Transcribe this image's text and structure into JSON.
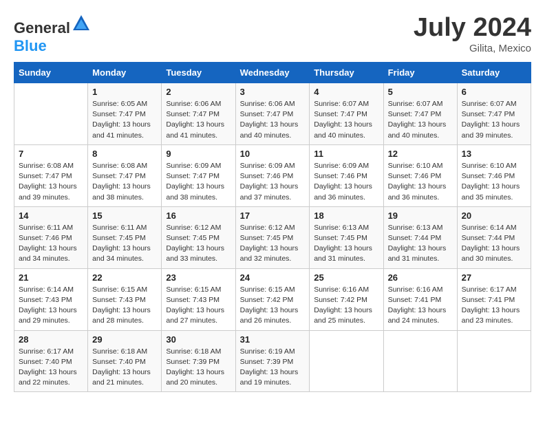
{
  "header": {
    "logo_general": "General",
    "logo_blue": "Blue",
    "month_year": "July 2024",
    "location": "Gilita, Mexico"
  },
  "days_of_week": [
    "Sunday",
    "Monday",
    "Tuesday",
    "Wednesday",
    "Thursday",
    "Friday",
    "Saturday"
  ],
  "weeks": [
    [
      {
        "day": "",
        "info": ""
      },
      {
        "day": "1",
        "info": "Sunrise: 6:05 AM\nSunset: 7:47 PM\nDaylight: 13 hours and 41 minutes."
      },
      {
        "day": "2",
        "info": "Sunrise: 6:06 AM\nSunset: 7:47 PM\nDaylight: 13 hours and 41 minutes."
      },
      {
        "day": "3",
        "info": "Sunrise: 6:06 AM\nSunset: 7:47 PM\nDaylight: 13 hours and 40 minutes."
      },
      {
        "day": "4",
        "info": "Sunrise: 6:07 AM\nSunset: 7:47 PM\nDaylight: 13 hours and 40 minutes."
      },
      {
        "day": "5",
        "info": "Sunrise: 6:07 AM\nSunset: 7:47 PM\nDaylight: 13 hours and 40 minutes."
      },
      {
        "day": "6",
        "info": "Sunrise: 6:07 AM\nSunset: 7:47 PM\nDaylight: 13 hours and 39 minutes."
      }
    ],
    [
      {
        "day": "7",
        "info": ""
      },
      {
        "day": "8",
        "info": "Sunrise: 6:08 AM\nSunset: 7:47 PM\nDaylight: 13 hours and 38 minutes."
      },
      {
        "day": "9",
        "info": "Sunrise: 6:09 AM\nSunset: 7:47 PM\nDaylight: 13 hours and 38 minutes."
      },
      {
        "day": "10",
        "info": "Sunrise: 6:09 AM\nSunset: 7:46 PM\nDaylight: 13 hours and 37 minutes."
      },
      {
        "day": "11",
        "info": "Sunrise: 6:09 AM\nSunset: 7:46 PM\nDaylight: 13 hours and 36 minutes."
      },
      {
        "day": "12",
        "info": "Sunrise: 6:10 AM\nSunset: 7:46 PM\nDaylight: 13 hours and 36 minutes."
      },
      {
        "day": "13",
        "info": "Sunrise: 6:10 AM\nSunset: 7:46 PM\nDaylight: 13 hours and 35 minutes."
      }
    ],
    [
      {
        "day": "14",
        "info": ""
      },
      {
        "day": "15",
        "info": "Sunrise: 6:11 AM\nSunset: 7:45 PM\nDaylight: 13 hours and 34 minutes."
      },
      {
        "day": "16",
        "info": "Sunrise: 6:12 AM\nSunset: 7:45 PM\nDaylight: 13 hours and 33 minutes."
      },
      {
        "day": "17",
        "info": "Sunrise: 6:12 AM\nSunset: 7:45 PM\nDaylight: 13 hours and 32 minutes."
      },
      {
        "day": "18",
        "info": "Sunrise: 6:13 AM\nSunset: 7:45 PM\nDaylight: 13 hours and 31 minutes."
      },
      {
        "day": "19",
        "info": "Sunrise: 6:13 AM\nSunset: 7:44 PM\nDaylight: 13 hours and 31 minutes."
      },
      {
        "day": "20",
        "info": "Sunrise: 6:14 AM\nSunset: 7:44 PM\nDaylight: 13 hours and 30 minutes."
      }
    ],
    [
      {
        "day": "21",
        "info": ""
      },
      {
        "day": "22",
        "info": "Sunrise: 6:15 AM\nSunset: 7:43 PM\nDaylight: 13 hours and 28 minutes."
      },
      {
        "day": "23",
        "info": "Sunrise: 6:15 AM\nSunset: 7:43 PM\nDaylight: 13 hours and 27 minutes."
      },
      {
        "day": "24",
        "info": "Sunrise: 6:15 AM\nSunset: 7:42 PM\nDaylight: 13 hours and 26 minutes."
      },
      {
        "day": "25",
        "info": "Sunrise: 6:16 AM\nSunset: 7:42 PM\nDaylight: 13 hours and 25 minutes."
      },
      {
        "day": "26",
        "info": "Sunrise: 6:16 AM\nSunset: 7:41 PM\nDaylight: 13 hours and 24 minutes."
      },
      {
        "day": "27",
        "info": "Sunrise: 6:17 AM\nSunset: 7:41 PM\nDaylight: 13 hours and 23 minutes."
      }
    ],
    [
      {
        "day": "28",
        "info": "Sunrise: 6:17 AM\nSunset: 7:40 PM\nDaylight: 13 hours and 22 minutes."
      },
      {
        "day": "29",
        "info": "Sunrise: 6:18 AM\nSunset: 7:40 PM\nDaylight: 13 hours and 21 minutes."
      },
      {
        "day": "30",
        "info": "Sunrise: 6:18 AM\nSunset: 7:39 PM\nDaylight: 13 hours and 20 minutes."
      },
      {
        "day": "31",
        "info": "Sunrise: 6:19 AM\nSunset: 7:39 PM\nDaylight: 13 hours and 19 minutes."
      },
      {
        "day": "",
        "info": ""
      },
      {
        "day": "",
        "info": ""
      },
      {
        "day": "",
        "info": ""
      }
    ]
  ],
  "week1_day7_info": "Sunrise: 6:08 AM\nSunset: 7:47 PM\nDaylight: 13 hours and 39 minutes.",
  "week2_day7_info": "Sunrise: 6:11 AM\nSunset: 7:46 PM\nDaylight: 13 hours and 34 minutes.",
  "week3_day14_info": "Sunrise: 6:11 AM\nSunset: 7:46 PM\nDaylight: 13 hours and 34 minutes.",
  "week4_day21_info": "Sunrise: 6:14 AM\nSunset: 7:43 PM\nDaylight: 13 hours and 29 minutes."
}
